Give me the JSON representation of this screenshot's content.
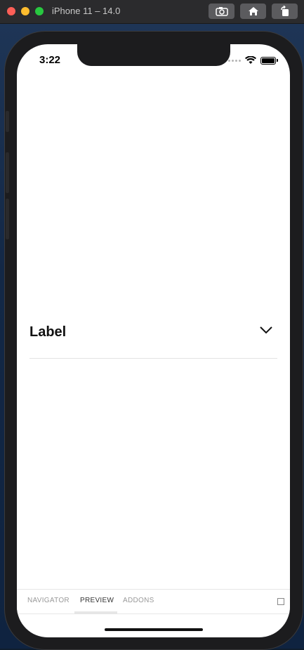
{
  "window": {
    "title": "iPhone 11 – 14.0"
  },
  "toolbar": [
    {
      "name": "screenshot-button",
      "icon": "camera-icon"
    },
    {
      "name": "home-button",
      "icon": "home-icon"
    },
    {
      "name": "rotate-button",
      "icon": "rotate-icon"
    }
  ],
  "status_bar": {
    "time": "3:22"
  },
  "content": {
    "label": "Label",
    "chevron_icon": "chevron-down-icon"
  },
  "addons_bar": {
    "tabs": [
      {
        "label": "NAVIGATOR",
        "active": false
      },
      {
        "label": "PREVIEW",
        "active": true
      },
      {
        "label": "ADDONS",
        "active": false
      }
    ]
  }
}
